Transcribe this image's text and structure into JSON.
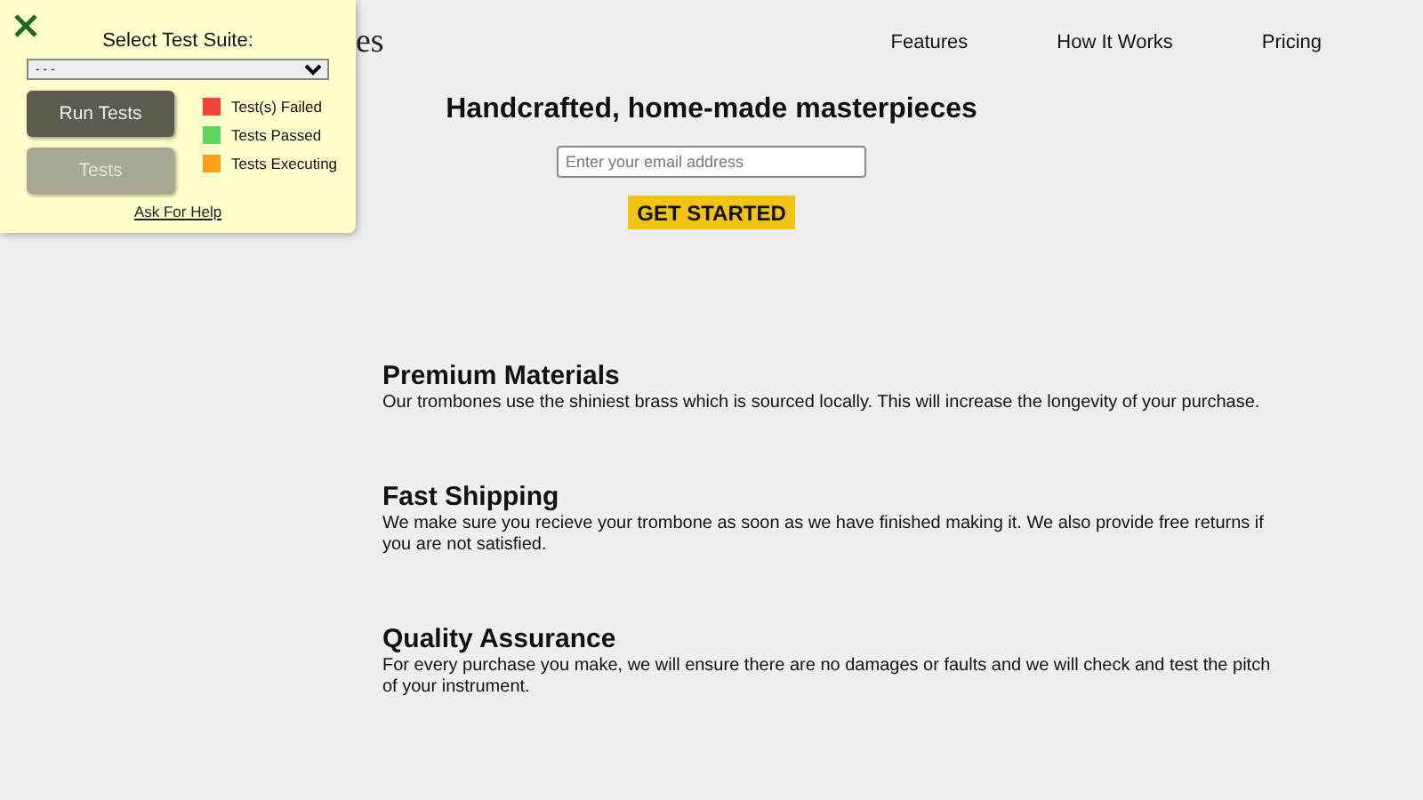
{
  "header": {
    "logo": "es",
    "nav": [
      {
        "label": "Features"
      },
      {
        "label": "How It Works"
      },
      {
        "label": "Pricing"
      }
    ]
  },
  "hero": {
    "title": "Handcrafted, home-made masterpieces",
    "email": {
      "placeholder": "Enter your email address"
    },
    "button": "GET STARTED"
  },
  "features": [
    {
      "title": "Premium Materials",
      "text": "Our trombones use the shiniest brass which is sourced locally. This will increase the longevity of your purchase."
    },
    {
      "title": "Fast Shipping",
      "text": "We make sure you recieve your trombone as soon as we have finished making it. We also provide free returns if you are not satisfied."
    },
    {
      "title": "Quality Assurance",
      "text": "For every purchase you make, we will ensure there are no damages or faults and we will check and test the pitch of your instrument."
    }
  ],
  "test_panel": {
    "label": "Select Test Suite:",
    "suite": "- - -",
    "buttons": [
      {
        "label": "Run Tests",
        "disabled": false
      },
      {
        "label": "Tests",
        "disabled": true
      }
    ],
    "legend": [
      {
        "label": "Test(s) Failed",
        "color": "#f44336"
      },
      {
        "label": "Tests Passed",
        "color": "#5cd65c"
      },
      {
        "label": "Tests Executing",
        "color": "#ff9f1a"
      }
    ],
    "help": "Ask For Help"
  }
}
